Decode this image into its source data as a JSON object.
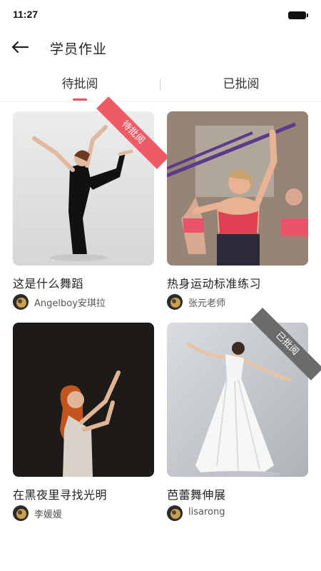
{
  "status": {
    "time": "11:27"
  },
  "nav": {
    "title": "学员作业"
  },
  "tabs": [
    {
      "label": "待批阅"
    },
    {
      "label": "已批阅"
    }
  ],
  "accent_color": "#e8505b",
  "works": [
    {
      "title": "这是什么舞蹈",
      "author": "Angelboy安琪拉",
      "badge": "待批阅",
      "badge_color": "#ee5a65"
    },
    {
      "title": "热身运动标准练习",
      "author": "张元老师",
      "badge": "",
      "badge_color": ""
    },
    {
      "title": "在黑夜里寻找光明",
      "author": "李媛媛",
      "badge": "",
      "badge_color": ""
    },
    {
      "title": "芭蕾舞伸展",
      "author": "lisarong",
      "badge": "已批阅",
      "badge_color": "#6b6b6b"
    }
  ]
}
